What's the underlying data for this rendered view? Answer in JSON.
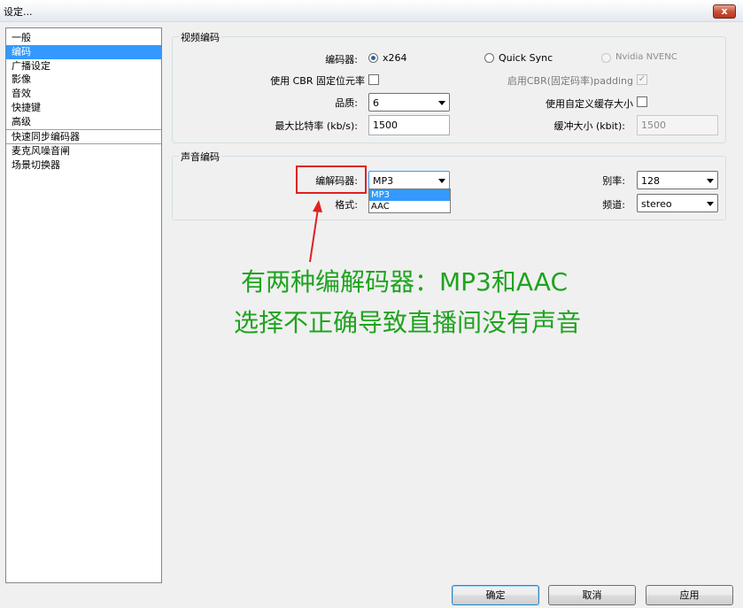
{
  "window": {
    "title": "设定...",
    "close_label": "x"
  },
  "sidebar": {
    "items": [
      {
        "label": "一般"
      },
      {
        "label": "编码"
      },
      {
        "label": "广播设定"
      },
      {
        "label": "影像"
      },
      {
        "label": "音效"
      },
      {
        "label": "快捷键"
      },
      {
        "label": "高级"
      },
      {
        "label": "快速同步编码器"
      },
      {
        "label": "麦克风噪音闸"
      },
      {
        "label": "场景切换器"
      }
    ],
    "selected": "编码"
  },
  "video": {
    "group_title": "视频编码",
    "encoder_label": "编码器:",
    "encoder_options": [
      "x264",
      "Quick Sync",
      "Nvidia NVENC"
    ],
    "encoder_selected": "x264",
    "cbr_label": "使用 CBR 固定位元率",
    "cbr_padding_label": "启用CBR(固定码率)padding",
    "cbr_padding_check": "✓",
    "quality_label": "品质:",
    "quality_value": "6",
    "custom_buffer_label": "使用自定义缓存大小",
    "max_bitrate_label": "最大比特率 (kb/s):",
    "max_bitrate_value": "1500",
    "buffer_size_label": "缓冲大小 (kbit):",
    "buffer_size_value": "1500"
  },
  "audio": {
    "group_title": "声音编码",
    "codec_label": "编解码器:",
    "codec_value": "MP3",
    "codec_options": [
      "MP3",
      "AAC"
    ],
    "format_label": "格式:",
    "bitrate_label": "别率:",
    "bitrate_value": "128",
    "channel_label": "频道:",
    "channel_value": "stereo"
  },
  "annotation": {
    "line1": "有两种编解码器：MP3和AAC",
    "line2": "选择不正确导致直播间没有声音",
    "color": "#1fa31f"
  },
  "buttons": {
    "ok": "确定",
    "cancel": "取消",
    "apply": "应用"
  }
}
